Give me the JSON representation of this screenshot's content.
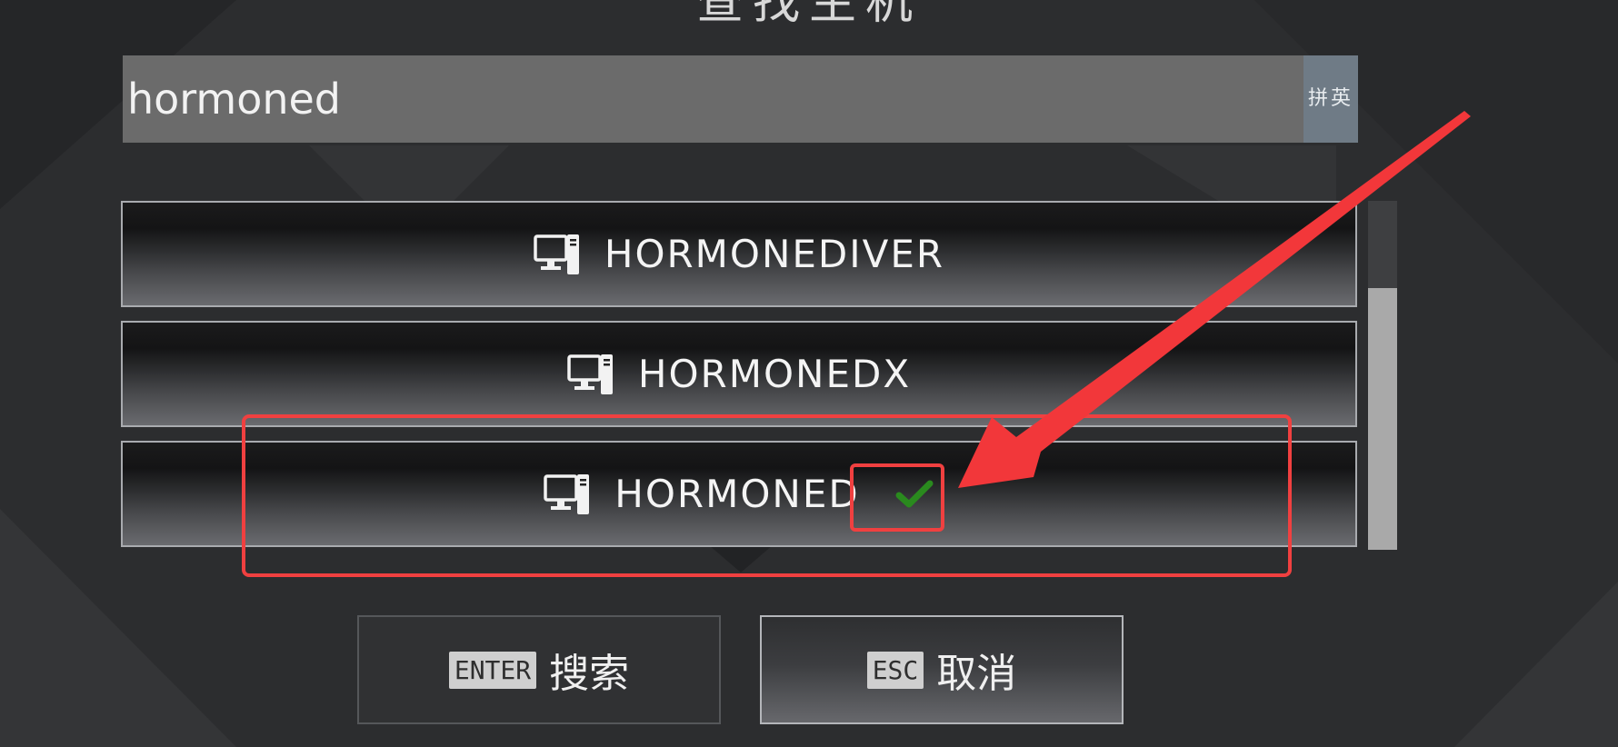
{
  "dialog": {
    "title": "查找主机"
  },
  "search": {
    "value": "hormoned",
    "ime_indicator": "拼英"
  },
  "results": [
    {
      "label": "HORMONEDIVER",
      "icon": "computer-icon",
      "selected": false
    },
    {
      "label": "HORMONEDX",
      "icon": "computer-icon",
      "selected": false
    },
    {
      "label": "HORMONED",
      "icon": "computer-icon",
      "selected": true
    }
  ],
  "scrollbar": {
    "thumb_position_fraction": 0.25,
    "thumb_size_fraction": 0.75
  },
  "buttons": {
    "search": {
      "key": "ENTER",
      "label": "搜索"
    },
    "cancel": {
      "key": "ESC",
      "label": "取消"
    }
  },
  "colors": {
    "background": "#2c2d2f",
    "search_bar": "#6b6b6b",
    "ime_indicator": "#6f7b86",
    "check_mark": "#2a8a1e",
    "annotation": "#f04040"
  }
}
